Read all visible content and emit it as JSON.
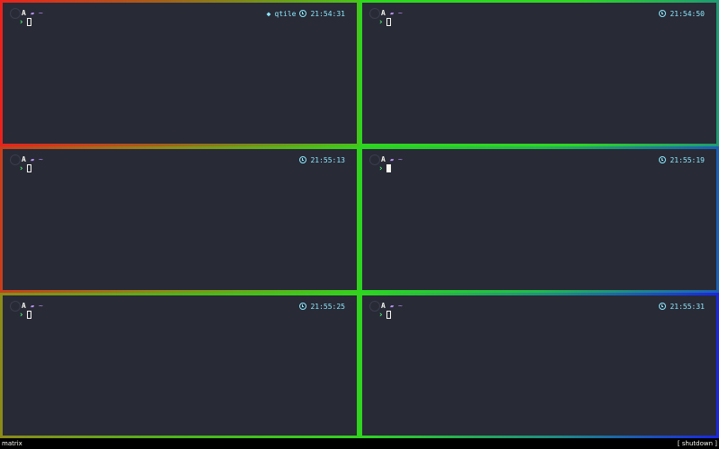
{
  "panes": [
    {
      "wm_label": "qtile",
      "time": "21:54:31",
      "cursor": "hollow",
      "arch_glyph": "A",
      "folder_glyph": "▰",
      "dir": "~",
      "prompt": "›"
    },
    {
      "wm_label": null,
      "time": "21:54:50",
      "cursor": "hollow",
      "arch_glyph": "A",
      "folder_glyph": "▰",
      "dir": "~",
      "prompt": "›"
    },
    {
      "wm_label": null,
      "time": "21:55:13",
      "cursor": "hollow",
      "arch_glyph": "A",
      "folder_glyph": "▰",
      "dir": "~",
      "prompt": "›"
    },
    {
      "wm_label": null,
      "time": "21:55:19",
      "cursor": "solid",
      "arch_glyph": "A",
      "folder_glyph": "▰",
      "dir": "~",
      "prompt": "›"
    },
    {
      "wm_label": null,
      "time": "21:55:25",
      "cursor": "hollow",
      "arch_glyph": "A",
      "folder_glyph": "▰",
      "dir": "~",
      "prompt": "›"
    },
    {
      "wm_label": null,
      "time": "21:55:31",
      "cursor": "hollow",
      "arch_glyph": "A",
      "folder_glyph": "▰",
      "dir": "~",
      "prompt": "›"
    }
  ],
  "bar": {
    "layout_name": "matrix",
    "shutdown_label": "[ shutdown ]"
  },
  "icons": {
    "wm": "diamond-icon",
    "clock": "clock-icon",
    "arch": "arch-linux-icon",
    "folder": "folder-icon",
    "prompt": "chevron-right-icon"
  },
  "colors": {
    "terminal_bg": "#282a36",
    "foreground": "#f8f8f2",
    "cyan": "#8be9fd",
    "green": "#50fa7b",
    "purple": "#bd93f9"
  }
}
